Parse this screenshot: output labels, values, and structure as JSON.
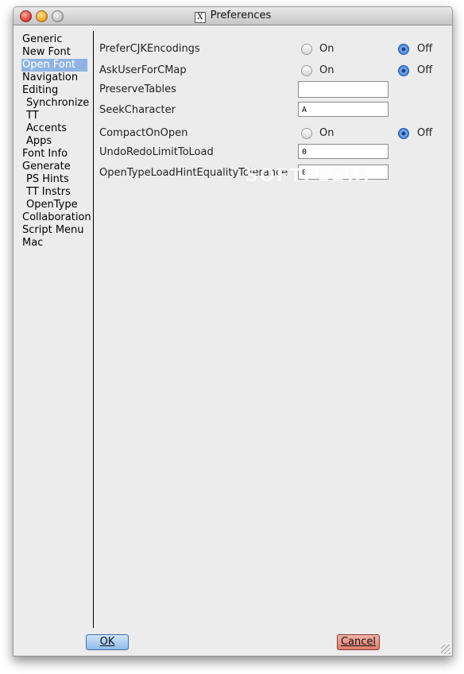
{
  "window": {
    "title": "Preferences",
    "title_icon": "x11-icon"
  },
  "sidebar": {
    "items": [
      {
        "label": "Generic",
        "sub": false,
        "selected": false
      },
      {
        "label": "New Font",
        "sub": false,
        "selected": false
      },
      {
        "label": "Open Font",
        "sub": false,
        "selected": true
      },
      {
        "label": "Navigation",
        "sub": false,
        "selected": false
      },
      {
        "label": "Editing",
        "sub": false,
        "selected": false
      },
      {
        "label": "Synchronize",
        "sub": true,
        "selected": false
      },
      {
        "label": "TT",
        "sub": true,
        "selected": false
      },
      {
        "label": "Accents",
        "sub": true,
        "selected": false
      },
      {
        "label": "Apps",
        "sub": true,
        "selected": false
      },
      {
        "label": "Font Info",
        "sub": false,
        "selected": false
      },
      {
        "label": "Generate",
        "sub": false,
        "selected": false
      },
      {
        "label": "PS Hints",
        "sub": true,
        "selected": false
      },
      {
        "label": "TT Instrs",
        "sub": true,
        "selected": false
      },
      {
        "label": "OpenType",
        "sub": true,
        "selected": false
      },
      {
        "label": "Collaboration",
        "sub": false,
        "selected": false
      },
      {
        "label": "Script Menu",
        "sub": false,
        "selected": false
      },
      {
        "label": "Mac",
        "sub": false,
        "selected": false
      }
    ]
  },
  "settings": {
    "prefer_cjk": {
      "label": "PreferCJKEncodings",
      "on_label": "On",
      "off_label": "Off",
      "value": "Off"
    },
    "ask_cmap": {
      "label": "AskUserForCMap",
      "on_label": "On",
      "off_label": "Off",
      "value": "Off"
    },
    "preserve_tables": {
      "label": "PreserveTables",
      "value": ""
    },
    "seek_character": {
      "label": "SeekCharacter",
      "value": "A"
    },
    "compact_on_open": {
      "label": "CompactOnOpen",
      "on_label": "On",
      "off_label": "Off",
      "value": "Off"
    },
    "undo_redo_limit": {
      "label": "UndoRedoLimitToLoad",
      "value": "0"
    },
    "opentype_hint_tol": {
      "label": "OpenTypeLoadHintEqualityTolerance",
      "value": "0"
    }
  },
  "watermark": "SOFTPEDIA",
  "buttons": {
    "ok": "OK",
    "cancel": "Cancel"
  },
  "colors": {
    "selection": "#8fb4e3",
    "ok_button": "#8fbbe9",
    "cancel_button": "#e07b6b"
  }
}
